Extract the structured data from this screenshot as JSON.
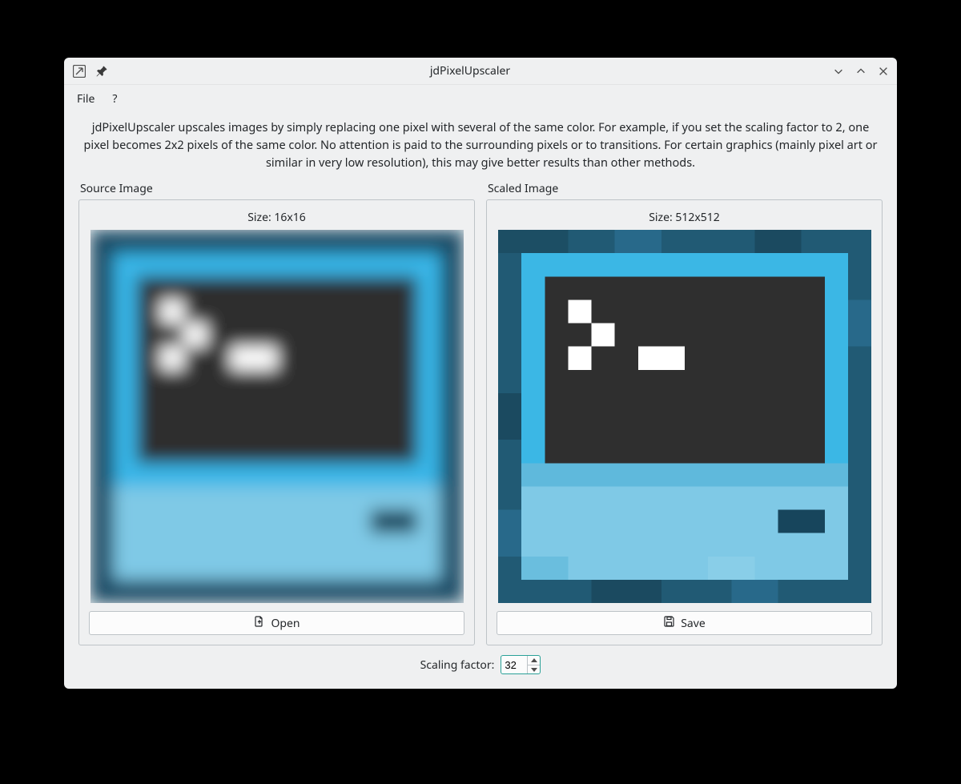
{
  "window": {
    "title": "jdPixelUpscaler"
  },
  "menu": {
    "file": "File",
    "help": "?"
  },
  "description": "jdPixelUpscaler upscales images by simply replacing one pixel with several of the same color. For example, if you set the scaling factor to 2, one pixel becomes 2x2 pixels of the same color. No attention is paid to the surrounding pixels or to transitions. For certain graphics (mainly pixel art or similar in very low resolution), this may give better results than other methods.",
  "source": {
    "group_label": "Source Image",
    "size_label": "Size: 16x16",
    "button_label": "Open"
  },
  "scaled": {
    "group_label": "Scaled Image",
    "size_label": "Size: 512x512",
    "button_label": "Save"
  },
  "factor": {
    "label": "Scaling factor:",
    "value": "32"
  }
}
